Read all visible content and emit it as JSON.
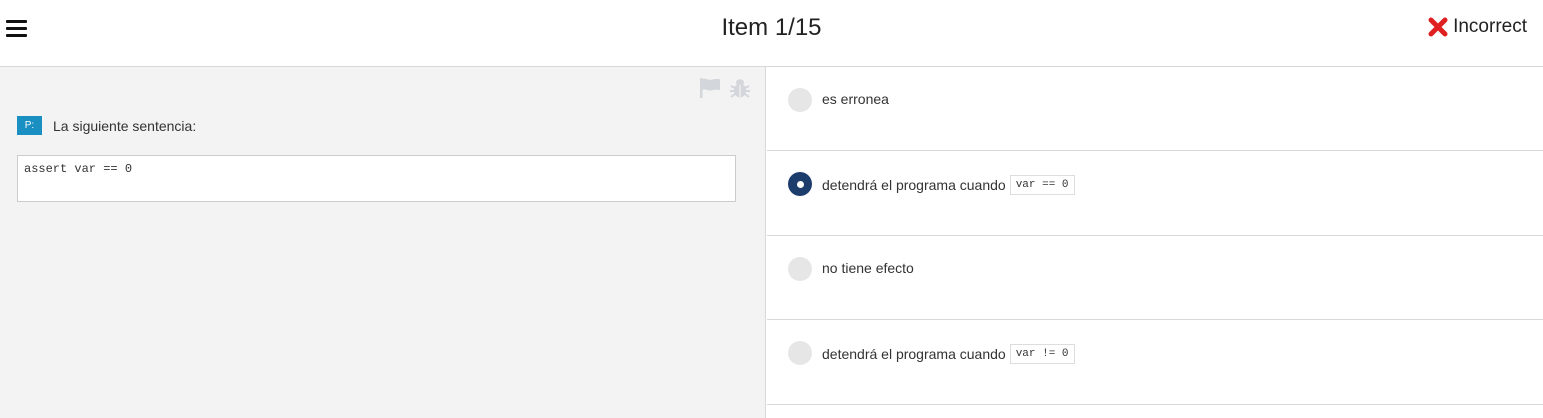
{
  "header": {
    "title": "Item 1/15",
    "status_label": "Incorrect",
    "status_color": "#e02020"
  },
  "toolbar": {
    "icons": [
      "flag-icon",
      "bug-icon"
    ]
  },
  "question": {
    "badge": "P:",
    "text": "La siguiente sentencia:",
    "code": "assert var == 0"
  },
  "options": [
    {
      "label": "es erronea",
      "code": "",
      "selected": false
    },
    {
      "label": "detendrá el programa cuando",
      "code": "var == 0",
      "selected": true
    },
    {
      "label": "no tiene efecto",
      "code": "",
      "selected": false
    },
    {
      "label": "detendrá el programa cuando",
      "code": "var != 0",
      "selected": false
    }
  ],
  "colors": {
    "accent": "#1c3c6c",
    "badge": "#1a8fc1",
    "incorrect": "#e02020"
  }
}
